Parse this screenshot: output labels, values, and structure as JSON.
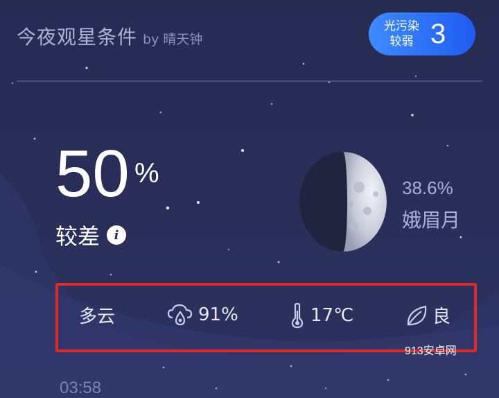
{
  "header": {
    "title": "今夜观星条件",
    "by_label": "by 晴天钟"
  },
  "light_pollution": {
    "label_line1": "光污染",
    "label_line2": "较弱",
    "level": "3",
    "accent_color": "#2f74ff"
  },
  "seeing": {
    "value": "50",
    "unit": "%",
    "rating": "较差",
    "info_icon": "info-icon"
  },
  "moon": {
    "illumination": "38.6%",
    "phase": "娥眉月",
    "icon": "moon-icon"
  },
  "conditions": {
    "highlight_color": "#e02a2a",
    "items": [
      {
        "label": "多云",
        "icon": ""
      },
      {
        "label": "91%",
        "icon": "humidity-cloud-icon"
      },
      {
        "label": "17℃",
        "icon": "thermometer-icon"
      },
      {
        "label": "良",
        "icon": "leaf-icon"
      }
    ]
  },
  "time": "03:58",
  "watermark": "913安卓网"
}
